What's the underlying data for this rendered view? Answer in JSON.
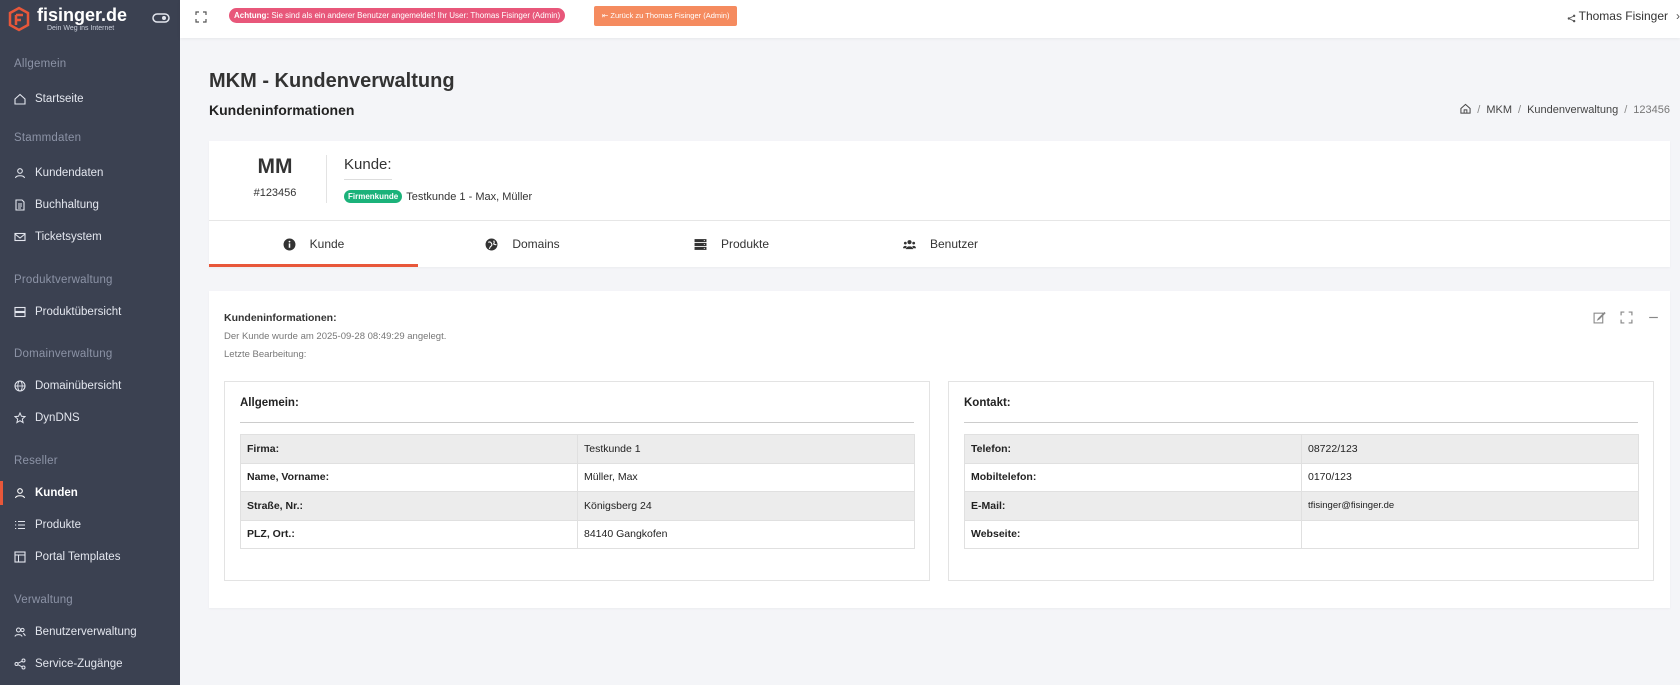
{
  "sidebar": {
    "logo_name": "fisinger.de",
    "logo_tagline": "Dein Weg ins Internet",
    "sections": [
      {
        "title": "Allgemein",
        "items": [
          {
            "label": "Startseite",
            "icon": "home-icon"
          }
        ]
      },
      {
        "title": "Stammdaten",
        "items": [
          {
            "label": "Kundendaten",
            "icon": "user-icon"
          },
          {
            "label": "Buchhaltung",
            "icon": "document-icon"
          },
          {
            "label": "Ticketsystem",
            "icon": "mail-icon"
          }
        ]
      },
      {
        "title": "Produktverwaltung",
        "items": [
          {
            "label": "Produktübersicht",
            "icon": "server-icon"
          }
        ]
      },
      {
        "title": "Domainverwaltung",
        "items": [
          {
            "label": "Domainübersicht",
            "icon": "globe-icon"
          },
          {
            "label": "DynDNS",
            "icon": "star-icon"
          }
        ]
      },
      {
        "title": "Reseller",
        "items": [
          {
            "label": "Kunden",
            "icon": "user-icon",
            "active": true
          },
          {
            "label": "Produkte",
            "icon": "list-icon"
          },
          {
            "label": "Portal Templates",
            "icon": "layout-icon"
          }
        ]
      },
      {
        "title": "Verwaltung",
        "items": [
          {
            "label": "Benutzerverwaltung",
            "icon": "users-icon"
          },
          {
            "label": "Service-Zugänge",
            "icon": "share-icon"
          }
        ]
      }
    ]
  },
  "topbar": {
    "warning_strong": "Achtung:",
    "warning_text": "Sie sind als ein anderer Benutzer angemeldet! Ihr User: Thomas Fisinger (Admin)",
    "back_button": "Zurück zu Thomas Fisinger (Admin)",
    "user_name": "Thomas Fisinger"
  },
  "page": {
    "title": "MKM - Kundenverwaltung",
    "subtitle": "Kundeninformationen",
    "breadcrumb": [
      "MKM",
      "Kundenverwaltung",
      "123456"
    ]
  },
  "customer": {
    "initials": "MM",
    "number": "#123456",
    "label": "Kunde:",
    "type_badge": "Firmenkunde",
    "name": "Testkunde 1 - Max, Müller",
    "tabs": [
      {
        "label": "Kunde",
        "icon": "info-icon",
        "active": true
      },
      {
        "label": "Domains",
        "icon": "globe-icon"
      },
      {
        "label": "Produkte",
        "icon": "server-icon"
      },
      {
        "label": "Benutzer",
        "icon": "users-icon"
      }
    ]
  },
  "info": {
    "title": "Kundeninformationen:",
    "created": "Der Kunde wurde am 2025-09-28 08:49:29 angelegt.",
    "last_edit": "Letzte Bearbeitung:",
    "general": {
      "title": "Allgemein:",
      "rows": [
        {
          "key": "Firma:",
          "value": "Testkunde 1"
        },
        {
          "key": "Name, Vorname:",
          "value": "Müller, Max"
        },
        {
          "key": "Straße, Nr.:",
          "value": "Königsberg 24"
        },
        {
          "key": "PLZ, Ort.:",
          "value": "84140 Gangkofen"
        }
      ]
    },
    "contact": {
      "title": "Kontakt:",
      "rows": [
        {
          "key": "Telefon:",
          "value": "08722/123"
        },
        {
          "key": "Mobiltelefon:",
          "value": "0170/123"
        },
        {
          "key": "E-Mail:",
          "value": "tfisinger@fisinger.de"
        },
        {
          "key": "Webseite:",
          "value": ""
        }
      ]
    }
  },
  "colors": {
    "sidebar_bg": "#3b4151",
    "accent": "#e8573a",
    "warning": "#e8577a",
    "back_button": "#f58b5f",
    "badge": "#1bb27a"
  }
}
